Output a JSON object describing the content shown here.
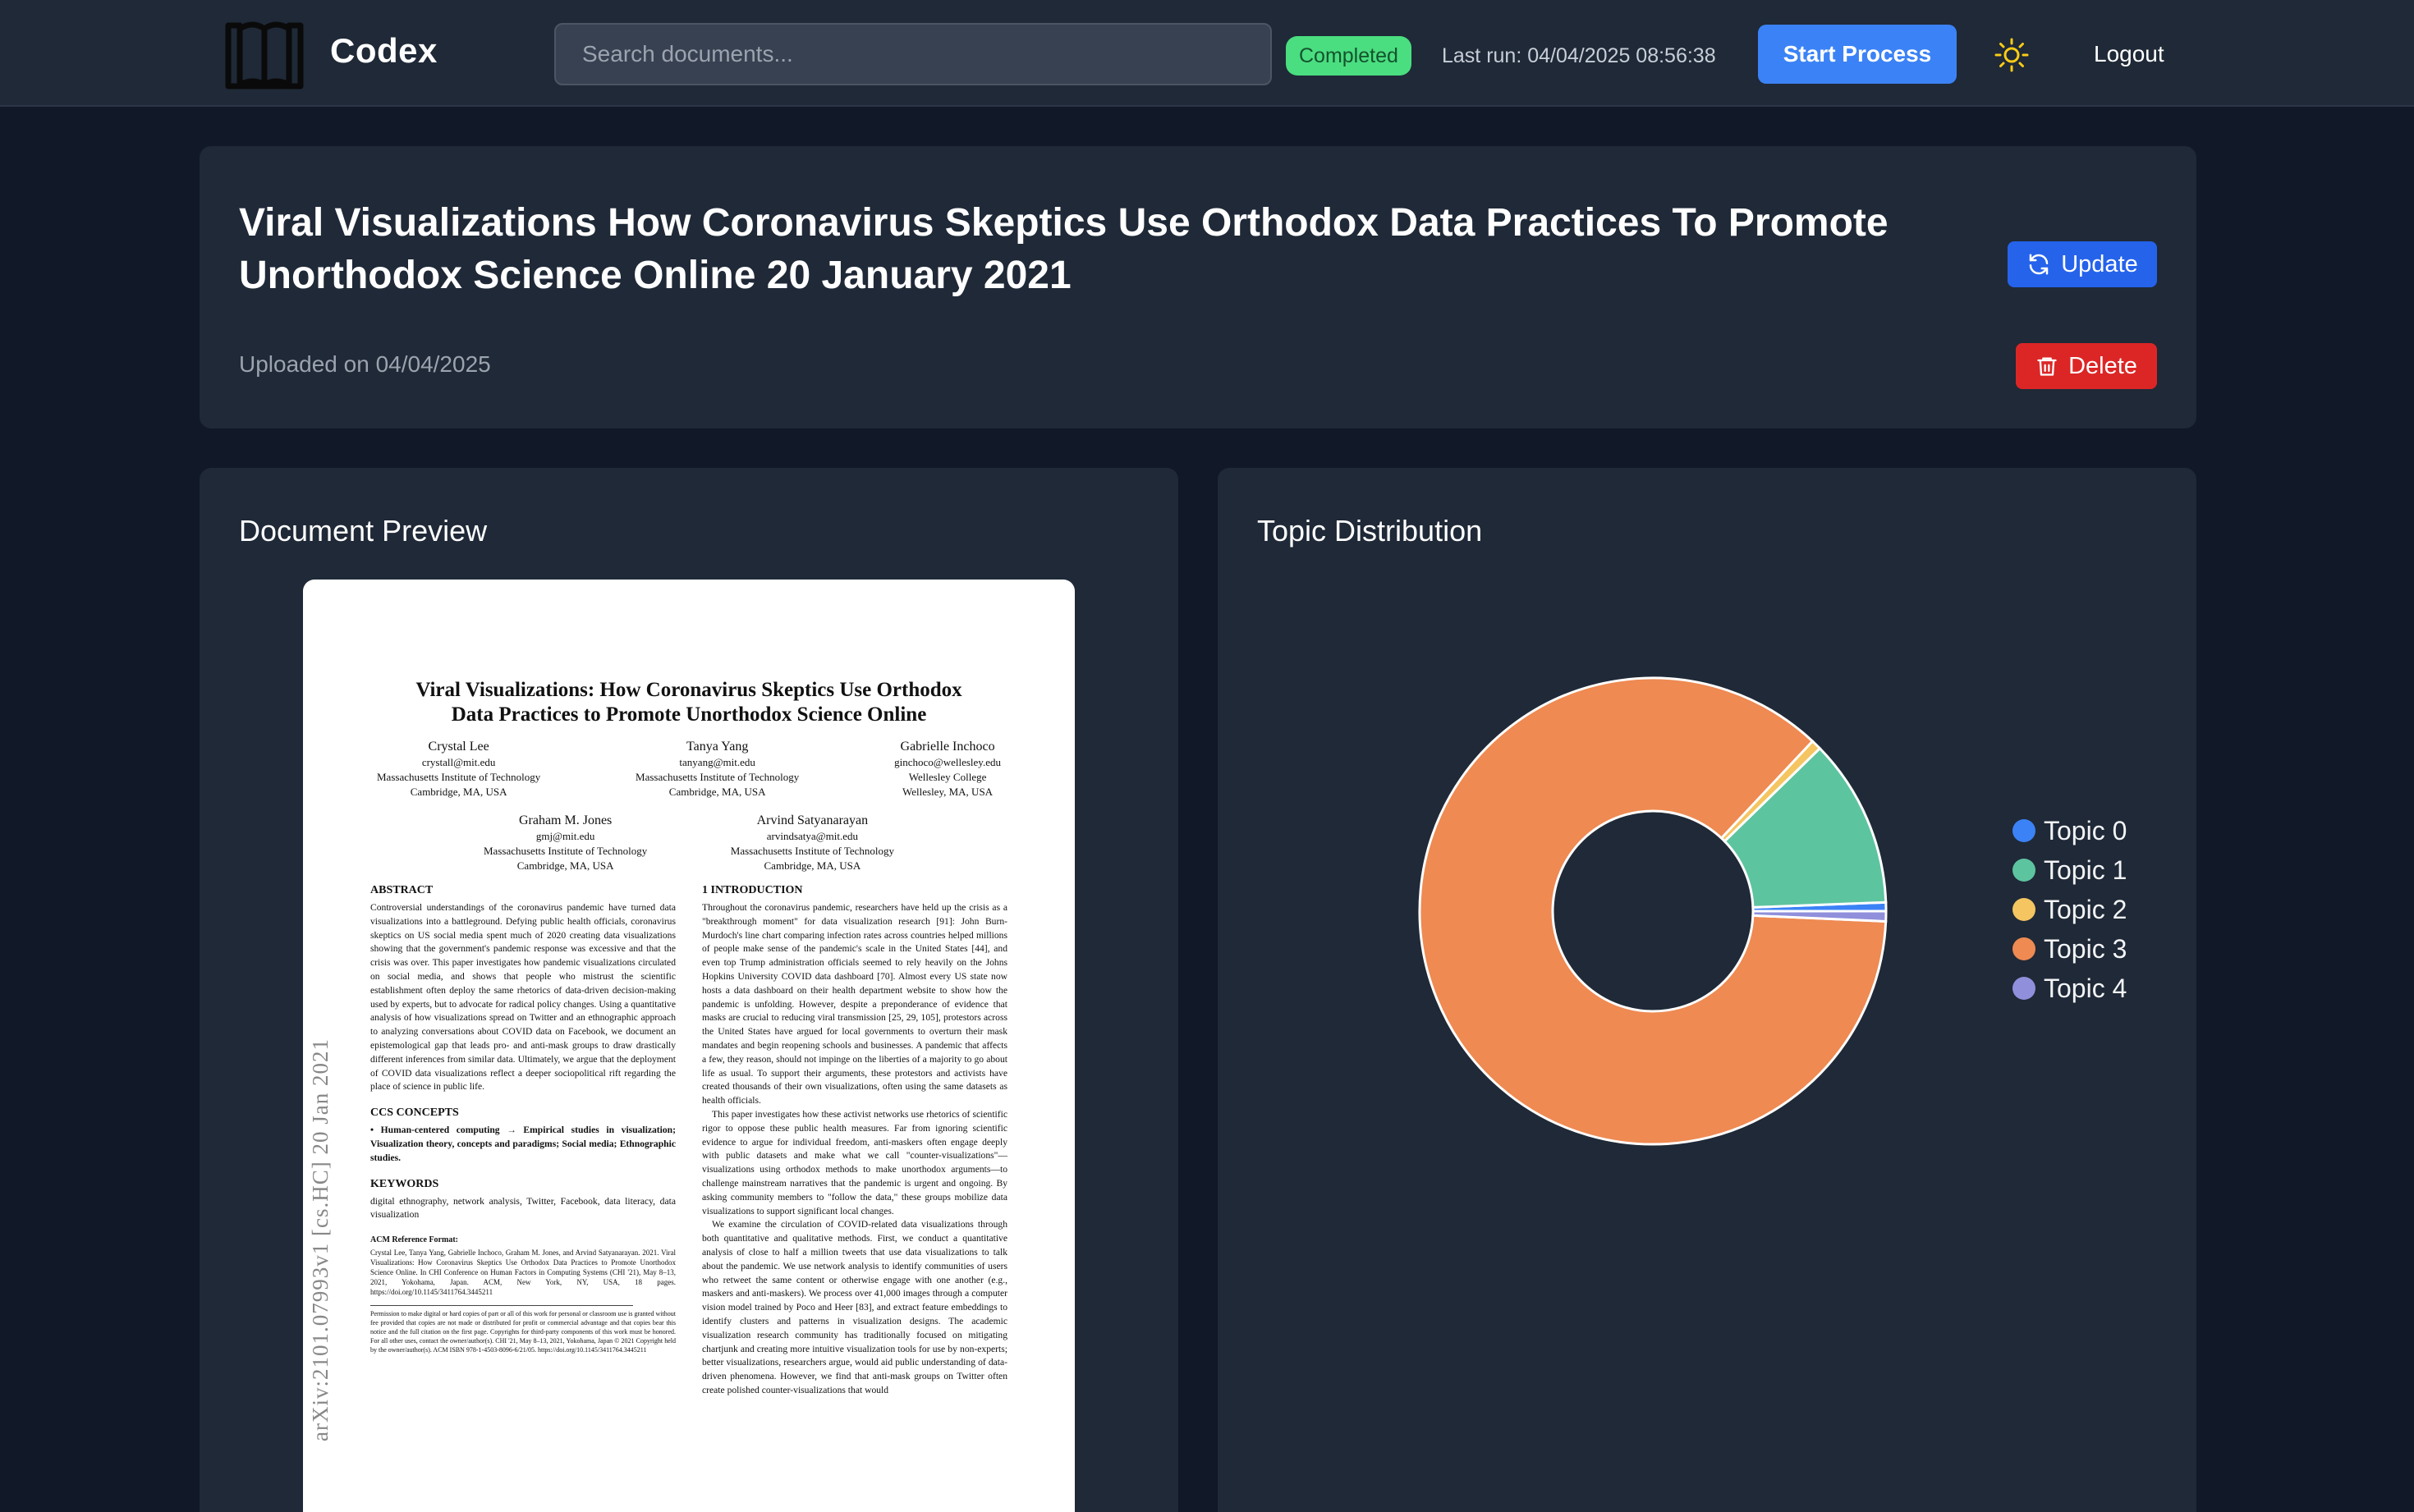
{
  "app": {
    "name": "Codex",
    "search_placeholder": "Search documents...",
    "status": "Completed",
    "last_run": "Last run: 04/04/2025 08:56:38",
    "start_process_label": "Start Process",
    "logout_label": "Logout",
    "status_color": "#4ade80",
    "accent_color": "#3b82f6"
  },
  "document": {
    "title": "Viral Visualizations How Coronavirus Skeptics Use Orthodox Data Practices To Promote Unorthodox Science Online 20 January 2021",
    "uploaded": "Uploaded on 04/04/2025",
    "update_label": "Update",
    "delete_label": "Delete"
  },
  "preview": {
    "heading": "Document Preview",
    "paper": {
      "title_line1": "Viral Visualizations: How Coronavirus Skeptics Use Orthodox",
      "title_line2": "Data Practices to Promote Unorthodox Science Online",
      "authors": [
        {
          "name": "Crystal Lee",
          "email": "crystall@mit.edu",
          "affiliation": "Massachusetts Institute of Technology",
          "location": "Cambridge, MA, USA"
        },
        {
          "name": "Tanya Yang",
          "email": "tanyang@mit.edu",
          "affiliation": "Massachusetts Institute of Technology",
          "location": "Cambridge, MA, USA"
        },
        {
          "name": "Gabrielle Inchoco",
          "email": "ginchoco@wellesley.edu",
          "affiliation": "Wellesley College",
          "location": "Wellesley, MA, USA"
        },
        {
          "name": "Graham M. Jones",
          "email": "gmj@mit.edu",
          "affiliation": "Massachusetts Institute of Technology",
          "location": "Cambridge, MA, USA"
        },
        {
          "name": "Arvind Satyanarayan",
          "email": "arvindsatya@mit.edu",
          "affiliation": "Massachusetts Institute of Technology",
          "location": "Cambridge, MA, USA"
        }
      ],
      "arxiv": "arXiv:2101.07993v1  [cs.HC]  20 Jan 2021",
      "abstract_heading": "ABSTRACT",
      "abstract": "Controversial understandings of the coronavirus pandemic have turned data visualizations into a battleground. Defying public health officials, coronavirus skeptics on US social media spent much of 2020 creating data visualizations showing that the government's pandemic response was excessive and that the crisis was over. This paper investigates how pandemic visualizations circulated on social media, and shows that people who mistrust the scientific establishment often deploy the same rhetorics of data-driven decision-making used by experts, but to advocate for radical policy changes. Using a quantitative analysis of how visualizations spread on Twitter and an ethnographic approach to analyzing conversations about COVID data on Facebook, we document an epistemological gap that leads pro- and anti-mask groups to draw drastically different inferences from similar data. Ultimately, we argue that the deployment of COVID data visualizations reflect a deeper sociopolitical rift regarding the place of science in public life.",
      "ccs_heading": "CCS CONCEPTS",
      "ccs": "• Human-centered computing → Empirical studies in visualization; Visualization theory, concepts and paradigms; Social media; Ethnographic studies.",
      "keywords_heading": "KEYWORDS",
      "keywords": "digital ethnography, network analysis, Twitter, Facebook, data literacy, data visualization",
      "ref_heading": "ACM Reference Format:",
      "ref": "Crystal Lee, Tanya Yang, Gabrielle Inchoco, Graham M. Jones, and Arvind Satyanarayan. 2021. Viral Visualizations: How Coronavirus Skeptics Use Orthodox Data Practices to Promote Unorthodox Science Online. In CHI Conference on Human Factors in Computing Systems (CHI '21), May 8–13, 2021, Yokohama, Japan. ACM, New York, NY, USA, 18 pages. https://doi.org/10.1145/3411764.3445211",
      "footnote": "Permission to make digital or hard copies of part or all of this work for personal or classroom use is granted without fee provided that copies are not made or distributed for profit or commercial advantage and that copies bear this notice and the full citation on the first page. Copyrights for third-party components of this work must be honored. For all other uses, contact the owner/author(s). CHI '21, May 8–13, 2021, Yokohama, Japan © 2021 Copyright held by the owner/author(s). ACM ISBN 978-1-4503-8096-6/21/05. https://doi.org/10.1145/3411764.3445211",
      "intro_heading": "1   INTRODUCTION",
      "intro_p1": "Throughout the coronavirus pandemic, researchers have held up the crisis as a \"breakthrough moment\" for data visualization research [91]: John Burn-Murdoch's line chart comparing infection rates across countries helped millions of people make sense of the pandemic's scale in the United States [44], and even top Trump administration officials seemed to rely heavily on the Johns Hopkins University COVID data dashboard [70]. Almost every US state now hosts a data dashboard on their health department website to show how the pandemic is unfolding. However, despite a preponderance of evidence that masks are crucial to reducing viral transmission [25, 29, 105], protestors across the United States have argued for local governments to overturn their mask mandates and begin reopening schools and businesses. A pandemic that affects a few, they reason, should not impinge on the liberties of a majority to go about life as usual. To support their arguments, these protestors and activists have created thousands of their own visualizations, often using the same datasets as health officials.",
      "intro_p2": "This paper investigates how these activist networks use rhetorics of scientific rigor to oppose these public health measures. Far from ignoring scientific evidence to argue for individual freedom, anti-maskers often engage deeply with public datasets and make what we call \"counter-visualizations\"—visualizations using orthodox methods to make unorthodox arguments—to challenge mainstream narratives that the pandemic is urgent and ongoing. By asking community members to \"follow the data,\" these groups mobilize data visualizations to support significant local changes.",
      "intro_p3": "We examine the circulation of COVID-related data visualizations through both quantitative and qualitative methods. First, we conduct a quantitative analysis of close to half a million tweets that use data visualizations to talk about the pandemic. We use network analysis to identify communities of users who retweet the same content or otherwise engage with one another (e.g., maskers and anti-maskers). We process over 41,000 images through a computer vision model trained by Poco and Heer [83], and extract feature embeddings to identify clusters and patterns in visualization designs. The academic visualization research community has traditionally focused on mitigating chartjunk and creating more intuitive visualization tools for use by non-experts; better visualizations, researchers argue, would aid public understanding of data-driven phenomena. However, we find that anti-mask groups on Twitter often create polished counter-visualizations that would"
    }
  },
  "topics": {
    "heading": "Topic Distribution"
  },
  "chart_data": {
    "type": "pie",
    "donut": true,
    "categories": [
      "Topic 0",
      "Topic 1",
      "Topic 2",
      "Topic 3",
      "Topic 4"
    ],
    "values": [
      0.6,
      11.7,
      0.7,
      86.3,
      0.7
    ],
    "colors": [
      "#3b82f6",
      "#5dc4a0",
      "#f4c561",
      "#ee8a52",
      "#8f8fdb"
    ],
    "legend_position": "right"
  }
}
